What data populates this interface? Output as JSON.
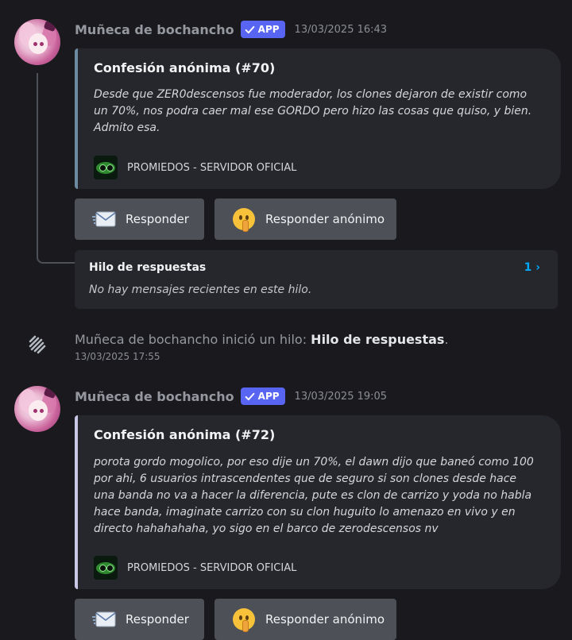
{
  "messages": [
    {
      "author": "Muñeca de bochancho",
      "badge": "APP",
      "timestamp": "13/03/2025 16:43",
      "embed_title": "Confesión anónima (#70)",
      "embed_description": "Desde que ZER0descensos fue moderador, los clones dejaron de existir como un 70%, nos podra caer mal ese GORDO pero hizo las cosas que quiso, y bien. Admito esa.",
      "footer": "PROMIEDOS - SERVIDOR OFICIAL",
      "buttons": [
        "Responder",
        "Responder anónimo"
      ]
    },
    {
      "author": "Muñeca de bochancho",
      "badge": "APP",
      "timestamp": "13/03/2025 19:05",
      "embed_title": "Confesión anónima (#72)",
      "embed_description": "porota gordo mogolico, por eso dije un 70%, el dawn dijo que baneó como 100 por ahi, 6 usuarios intrascendentes que de seguro si son clones desde hace una banda no va a hacer la diferencia, pute es clon de carrizo y yoda no habla hace banda, imaginate carrizo con su clon huguito lo amenazo en vivo y en directo hahahahaha, yo sigo en el barco de zerodescensos nv",
      "footer": "PROMIEDOS - SERVIDOR OFICIAL",
      "buttons": [
        "Responder",
        "Responder anónimo"
      ]
    }
  ],
  "thread": {
    "title": "Hilo de respuestas",
    "count": "1 ›",
    "empty_text": "No hay mensajes recientes en este hilo."
  },
  "system_message": {
    "author": "Muñeca de bochancho",
    "text": " inició un hilo: ",
    "thread_name": "Hilo de respuestas",
    "suffix": ".",
    "timestamp": "13/03/2025 17:55"
  },
  "icons": {
    "badge": "checkmark-icon",
    "reply": "envelope-icon",
    "anonymous_reply": "shushing-face-icon",
    "thread_start": "thread-icon",
    "footer": "server-logo-icon"
  },
  "colors": {
    "background": "#1a1a1e",
    "embed_bg": "#26272c",
    "app_badge": "#5865f2",
    "button": "#4e5058",
    "thread_count": "#00a8fc",
    "embed_border_1": "#6d8ba0",
    "embed_border_2": "#c8c8e6"
  }
}
